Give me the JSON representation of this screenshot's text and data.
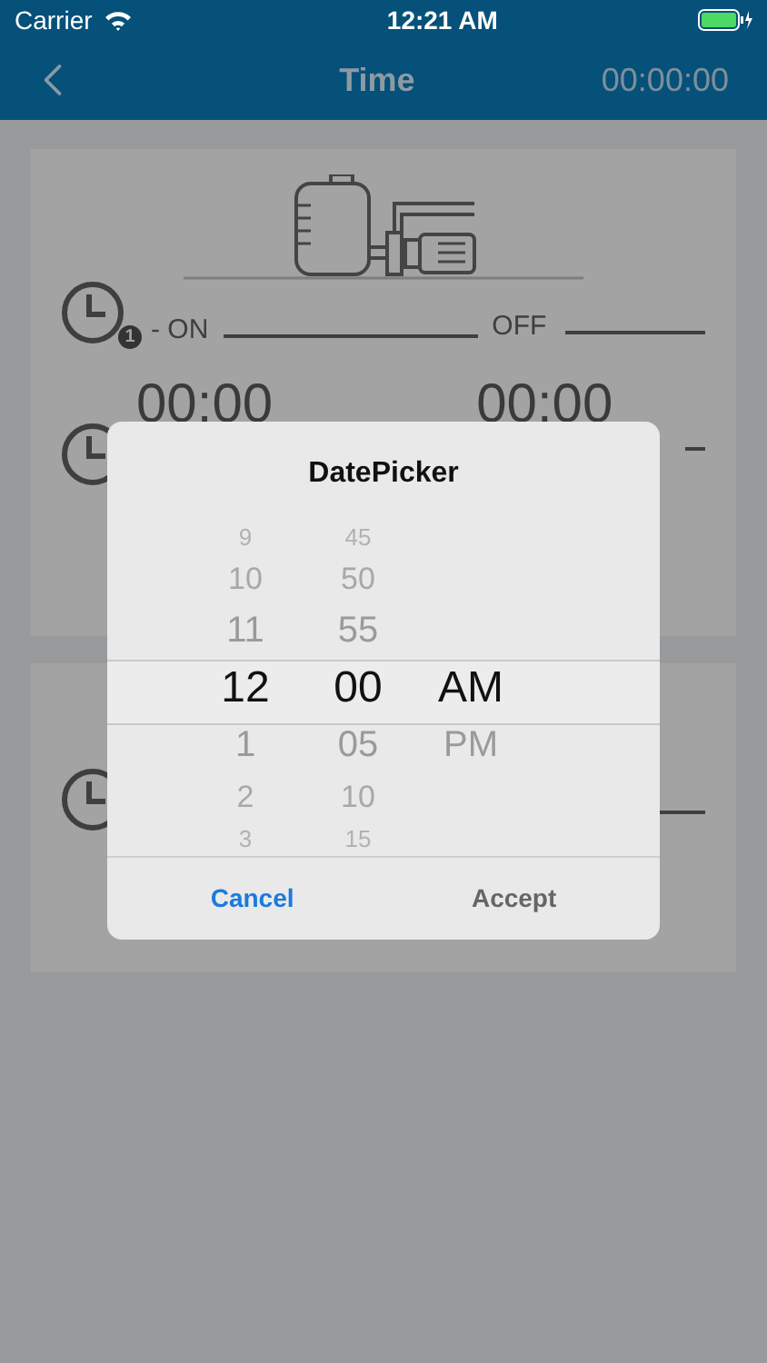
{
  "status_bar": {
    "carrier": "Carrier",
    "time": "12:21 AM"
  },
  "nav": {
    "title": "Time",
    "timer": "00:00:00"
  },
  "schedule": {
    "badge": "1",
    "on_label": "- ON",
    "off_label": "OFF",
    "on_time": "00:00",
    "off_time": "00:00"
  },
  "dialog": {
    "title": "DatePicker",
    "columns": [
      {
        "items": [
          {
            "label": "9",
            "selected": false
          },
          {
            "label": "10",
            "selected": false
          },
          {
            "label": "11",
            "selected": false
          },
          {
            "label": "12",
            "selected": true
          },
          {
            "label": "1",
            "selected": false
          },
          {
            "label": "2",
            "selected": false
          },
          {
            "label": "3",
            "selected": false
          }
        ]
      },
      {
        "items": [
          {
            "label": "45",
            "selected": false
          },
          {
            "label": "50",
            "selected": false
          },
          {
            "label": "55",
            "selected": false
          },
          {
            "label": "00",
            "selected": true
          },
          {
            "label": "05",
            "selected": false
          },
          {
            "label": "10",
            "selected": false
          },
          {
            "label": "15",
            "selected": false
          }
        ]
      },
      {
        "items": [
          {
            "label": "AM",
            "selected": true
          },
          {
            "label": "PM",
            "selected": false
          }
        ]
      }
    ],
    "buttons": [
      {
        "label": "Cancel",
        "kind": "primary"
      },
      {
        "label": "Accept",
        "kind": "secondary"
      }
    ]
  }
}
